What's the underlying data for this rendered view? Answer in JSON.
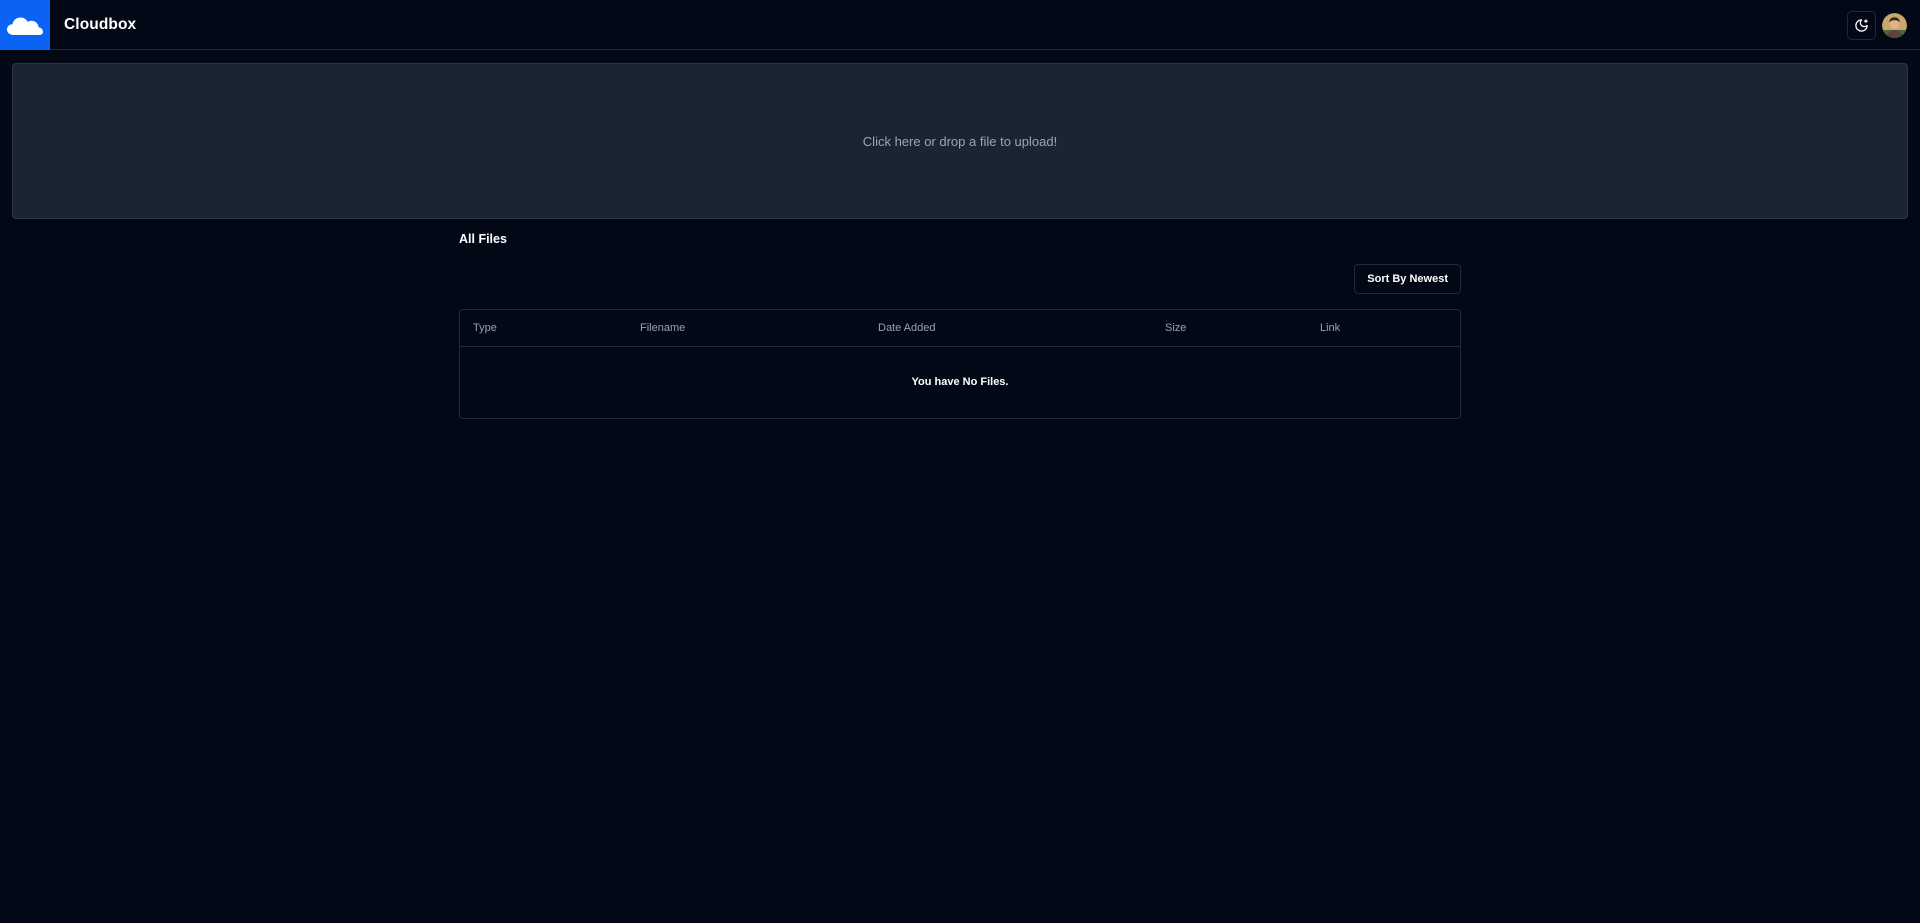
{
  "header": {
    "app_title": "Cloudbox",
    "logo_icon": "cloud-icon",
    "theme_icon": "moon-icon",
    "brand_color": "#0b63f6"
  },
  "upload": {
    "prompt": "Click here or drop a file to upload!"
  },
  "files": {
    "title": "All Files",
    "sort_label": "Sort By Newest",
    "columns": [
      "Type",
      "Filename",
      "Date Added",
      "Size",
      "Link"
    ],
    "empty_message": "You have No Files."
  }
}
